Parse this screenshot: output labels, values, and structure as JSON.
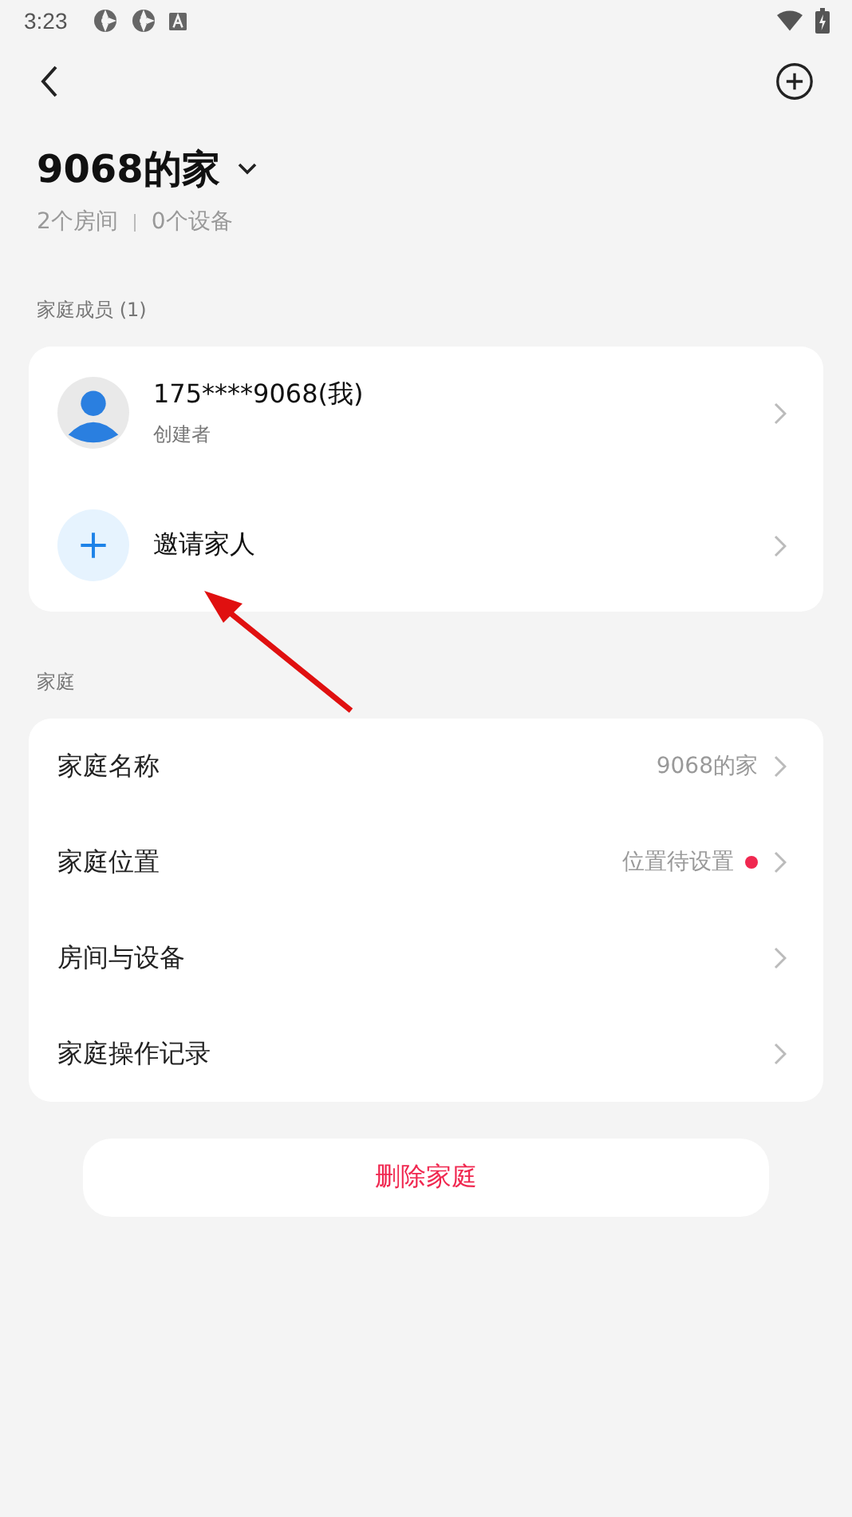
{
  "status_bar": {
    "time": "3:23"
  },
  "header": {
    "title": "9068的家",
    "rooms": "2个房间",
    "devices": "0个设备"
  },
  "members": {
    "heading": "家庭成员 (1)",
    "items": [
      {
        "kind": "member",
        "name": "175****9068(我)",
        "role": "创建者"
      },
      {
        "kind": "invite",
        "name": "邀请家人"
      }
    ]
  },
  "family": {
    "heading": "家庭",
    "items": [
      {
        "label": "家庭名称",
        "value": "9068的家",
        "alert": false
      },
      {
        "label": "家庭位置",
        "value": "位置待设置",
        "alert": true
      },
      {
        "label": "房间与设备",
        "alert": false
      },
      {
        "label": "家庭操作记录",
        "alert": false
      }
    ]
  },
  "delete_button": "删除家庭"
}
